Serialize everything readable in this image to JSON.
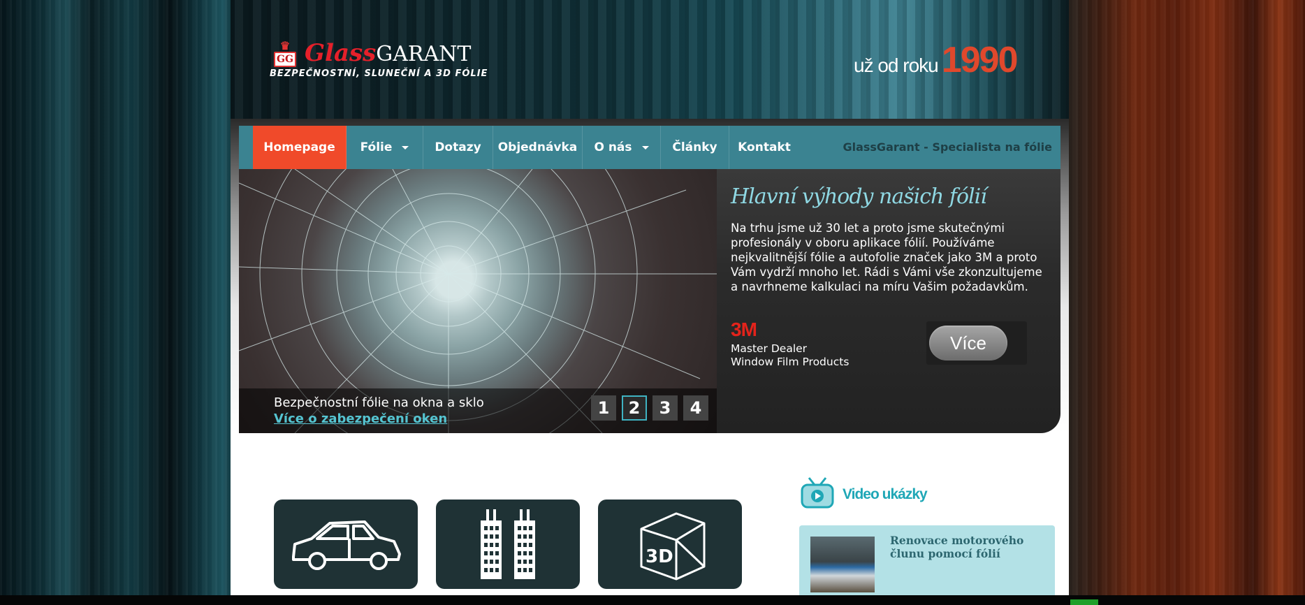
{
  "header": {
    "logo_crest": "GG",
    "logo_brand_part1": "Glass",
    "logo_brand_part2": "Garant",
    "logo_tagline": "BEZPEČNOSTNÍ, SLUNEČNÍ A 3D FÓLIE",
    "since_prefix": "už od roku",
    "since_year": "1990"
  },
  "nav": {
    "items": [
      {
        "label": "Homepage",
        "active": true,
        "dropdown": false
      },
      {
        "label": "Fólie",
        "active": false,
        "dropdown": true
      },
      {
        "label": "Dotazy",
        "active": false,
        "dropdown": false
      },
      {
        "label": "Objednávka",
        "active": false,
        "dropdown": false
      },
      {
        "label": "O nás",
        "active": false,
        "dropdown": true
      },
      {
        "label": "Články",
        "active": false,
        "dropdown": false
      },
      {
        "label": "Kontakt",
        "active": false,
        "dropdown": false
      }
    ],
    "slogan": "GlassGarant - Specialista na fólie"
  },
  "slider": {
    "caption_title": "Bezpečnostní fólie na okna a sklo",
    "caption_link": "Více o zabezpečení oken",
    "pages": [
      "1",
      "2",
      "3",
      "4"
    ],
    "active_page": "2"
  },
  "panel": {
    "title": "Hlavní výhody našich fólií",
    "text": "Na trhu jsme už 30 let a proto jsme skutečnými profesionály v oboru aplikace fólií. Používáme nejkvalitnější fólie a autofolie značek jako 3M a proto Vám vydrží mnoho let. Rádi s Vámi vše zkonzultujeme a navrhneme kalkulaci na míru Vašim požadavkům.",
    "brand": "3M",
    "brand_line1": "Master Dealer",
    "brand_line2": "Window Film Products",
    "more_button": "Více"
  },
  "tiles": [
    {
      "icon": "car-icon"
    },
    {
      "icon": "buildings-icon"
    },
    {
      "icon": "3d-box-icon",
      "icon_text": "3D"
    }
  ],
  "video": {
    "heading": "Video ukázky",
    "icon": "tv-icon",
    "items": [
      {
        "title": "Renovace motorového člunu pomocí fólií"
      }
    ]
  },
  "colors": {
    "nav_bg": "#3b8391",
    "nav_active": "#f04a2a",
    "accent_teal": "#1fa7b6",
    "year_red": "#e0482c",
    "tile_bg": "#1f3235",
    "video_card_bg": "#b3e1e6"
  }
}
